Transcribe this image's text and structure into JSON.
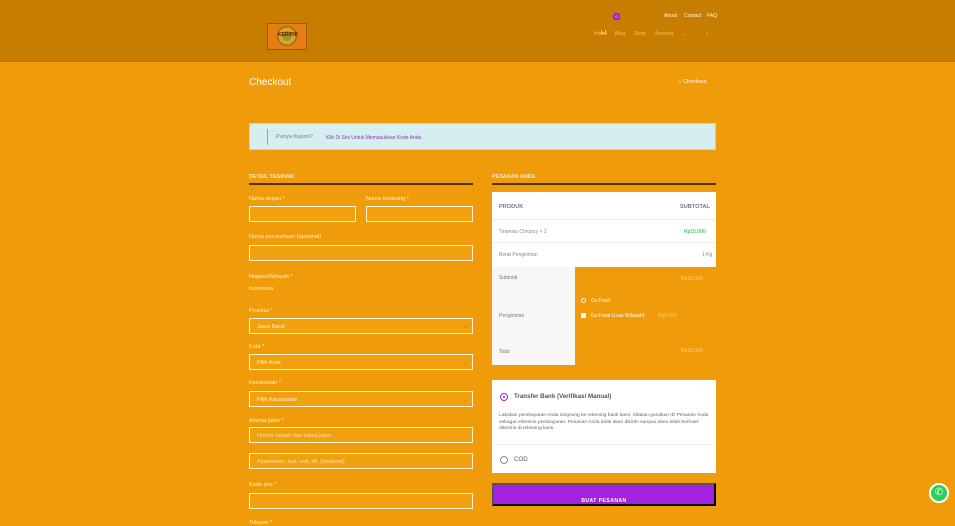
{
  "header": {
    "top_links": [
      "About",
      "Contact",
      "FAQ"
    ],
    "nav": [
      "Home",
      "Blog",
      "Shop",
      "Account"
    ],
    "cart_count": "0",
    "logo_text": "KERIPIK"
  },
  "page": {
    "title": "Checkout",
    "breadcrumb": "Checkout"
  },
  "coupon": {
    "prefix": "Punya Kupon?",
    "link": "Klik Di Sini Untuk Memasukkan Kode Anda"
  },
  "billing": {
    "title": "DETAIL TAGIHAN",
    "first_name_label": "Nama depan *",
    "last_name_label": "Nama belakang *",
    "company_label": "Nama perusahaan (opsional)",
    "country_label": "Negara/Wilayah *",
    "country_value": "Indonesia",
    "province_label": "Provinsi *",
    "province_value": "Jawa Barat",
    "city_label": "Kota *",
    "city_value": "Pilih Kota",
    "district_label": "Kecamatan *",
    "district_value": "Pilih Kecamatan",
    "street_label": "Alamat jalan *",
    "street_placeholder": "Nomor rumah dan nama jalan",
    "apartment_placeholder": "Apartemen, suit, unit, dll. (opsional)",
    "postal_label": "Kode pos *",
    "next_label": "Telepon *"
  },
  "order": {
    "title": "PESANAN ANDA",
    "product_col": "PRODUK",
    "subtotal_col": "SUBTOTAL",
    "item": "Tiramisu Chruncy × 1",
    "item_price": "Rp15.000",
    "weight_label": "Berat Pengiriman",
    "weight_value": "1 Kg",
    "subtotal_label": "Subtotal",
    "subtotal_value": "Rp15.000",
    "shipping_label": "Pengiriman",
    "shipping_option_1": "Go Food",
    "shipping_option_2": "Go Food (Luar Wilayah):",
    "shipping_option_2_price": "Rp5.000",
    "total_label": "Total",
    "total_value": "Rp15.000"
  },
  "payment": {
    "bank_label": "Transfer Bank (Verifikasi Manual)",
    "bank_desc": "Lakukan pembayaran Anda langsung ke rekening bank kami. Silakan gunakan ID Pesanan Anda sebagai referensi pembayaran. Pesanan Anda tidak akan dikirim sampai dana telah berhasil diterima di rekening kami.",
    "cod_label": "COD",
    "button_label": "BUAT PESANAN"
  },
  "colors": {
    "page_bg": "#f09b0a",
    "header_bg": "#c77d00",
    "accent_purple": "#a322e0",
    "success_green": "#2ccf54"
  },
  "icons": [
    "home-icon",
    "cart-icon",
    "search-icon",
    "whatsapp-icon",
    "chevron-down-icon"
  ]
}
